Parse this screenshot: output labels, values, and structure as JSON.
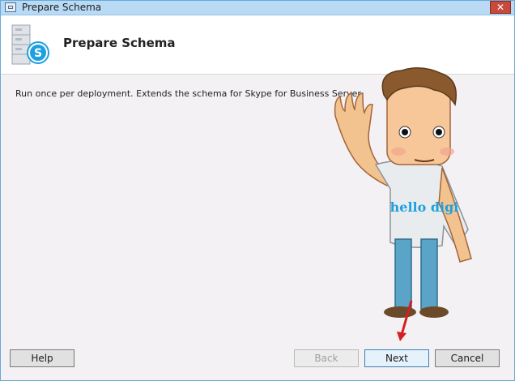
{
  "window": {
    "title": "Prepare Schema",
    "close_glyph": "✕"
  },
  "header": {
    "title": "Prepare Schema",
    "icon": "skype-server-icon"
  },
  "content": {
    "description": "Run once per deployment.  Extends the schema for Skype for Business Server.",
    "mascot_shirt_text": "hello digi"
  },
  "buttons": {
    "help": "Help",
    "back": "Back",
    "next": "Next",
    "cancel": "Cancel"
  },
  "colors": {
    "skype_blue": "#1ea0e0",
    "annotation_arrow": "#d42020",
    "primary_button_border": "#3c7fb1"
  }
}
